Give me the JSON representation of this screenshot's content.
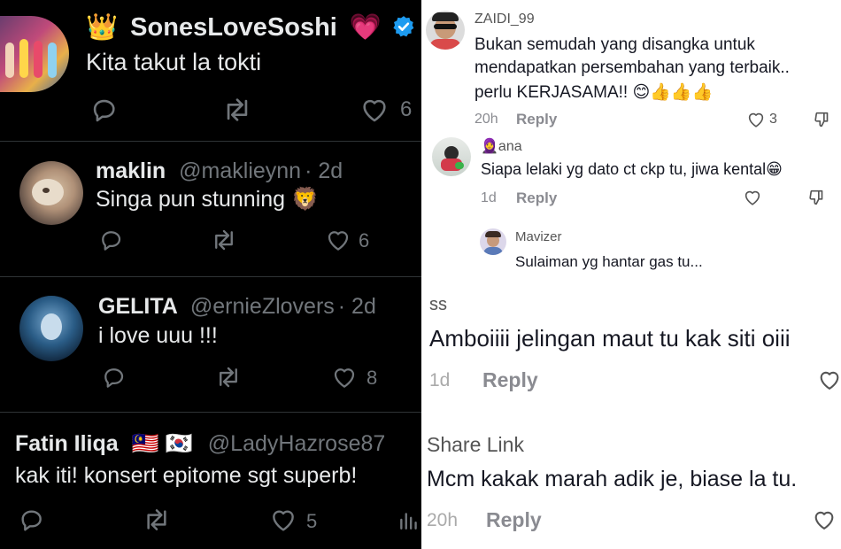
{
  "left": {
    "tweets": [
      {
        "emoji_prefix": "👑",
        "name": "SonesLoveSoshi",
        "badge": "💗",
        "handle": "",
        "time": "",
        "text": "Kita takut la tokti",
        "likes": "6"
      },
      {
        "name": "maklin",
        "handle": "@maklieynn",
        "time": "· 2d",
        "text": "Singa pun stunning 🦁",
        "likes": "6"
      },
      {
        "name": "GELITA",
        "handle": "@ernieZlovers",
        "time": "· 2d",
        "text": "i love uuu !!!",
        "likes": "8"
      },
      {
        "name": "Fatin Iliqa",
        "flags": "🇲🇾 🇰🇷",
        "handle": "@LadyHazrose87",
        "time": "",
        "text": "kak iti! konsert epitome sgt superb!",
        "likes": "5"
      }
    ]
  },
  "right": {
    "comments": [
      {
        "user": "ZAIDI_99",
        "lines": [
          "Bukan semudah yang disangka untuk",
          "mendapatkan persembahan yang terbaik..",
          "perlu KERJASAMA!! 😊👍👍👍"
        ],
        "time": "20h",
        "reply": "Reply",
        "likes": "3"
      },
      {
        "user_emoji": "🧕",
        "user": "ana",
        "text": "Siapa lelaki yg dato ct ckp tu, jiwa kental😁",
        "time": "1d",
        "reply": "Reply"
      },
      {
        "user": "Mavizer",
        "text": "Sulaiman yg hantar gas tu..."
      },
      {
        "user": "ss",
        "text": "Amboiiii jelingan maut tu kak siti oiii",
        "time": "1d",
        "reply": "Reply"
      },
      {
        "user": "Share Link",
        "text": "Mcm kakak marah adik je, biase la tu.",
        "time": "20h",
        "reply": "Reply"
      }
    ]
  }
}
